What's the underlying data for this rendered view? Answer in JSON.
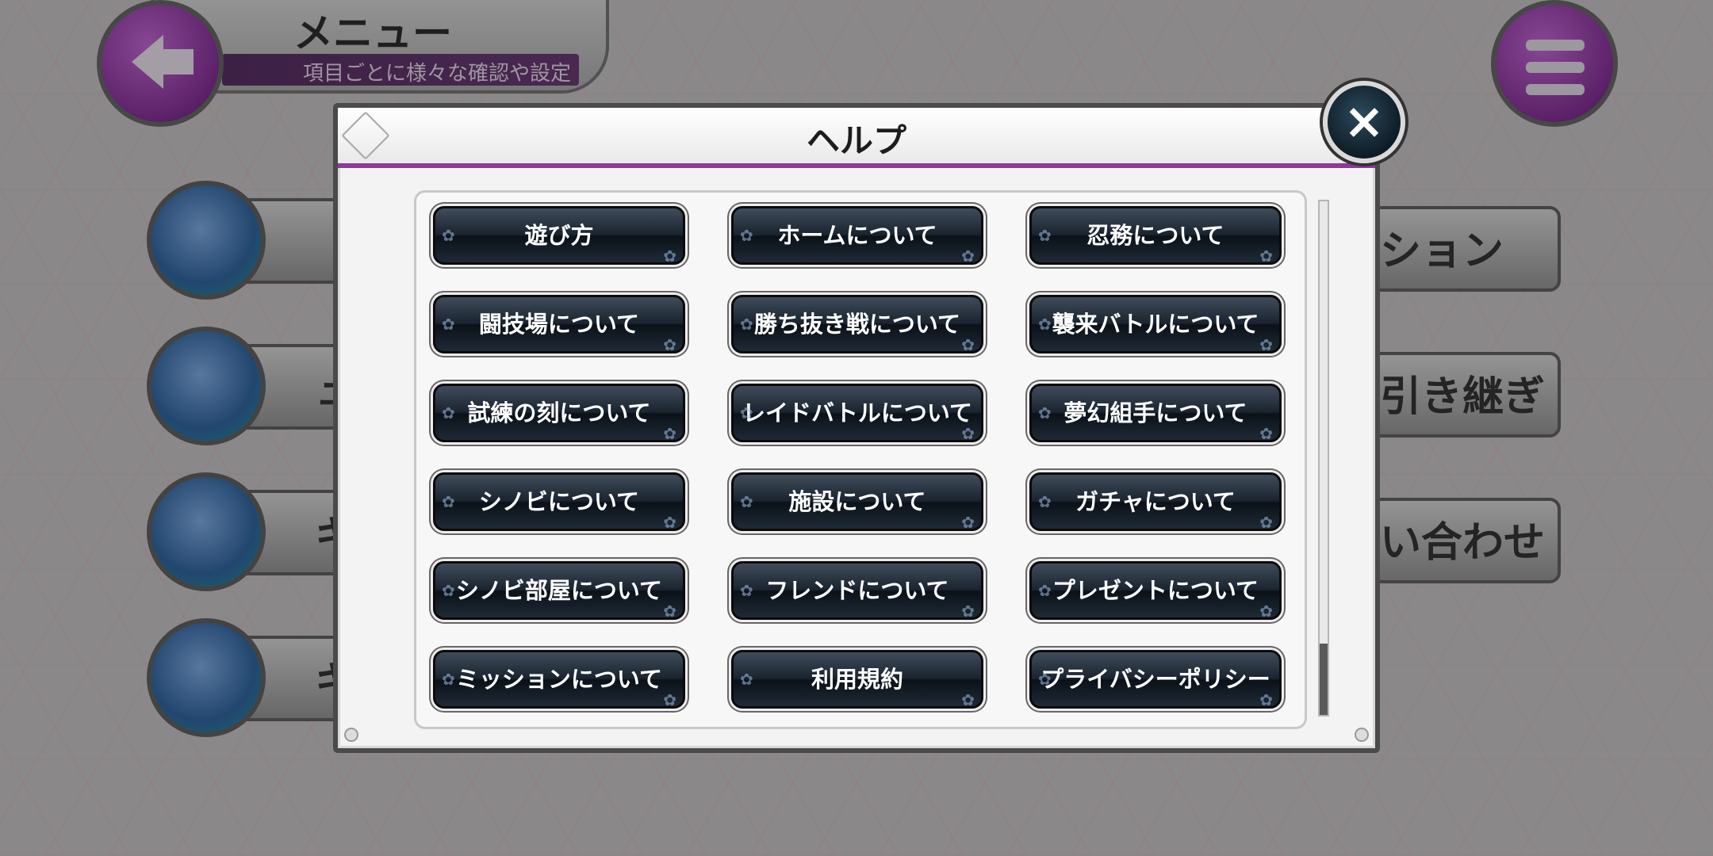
{
  "header": {
    "title": "メニュー",
    "subtitle": "項目ごとに様々な確認や設定"
  },
  "background_menu": {
    "items": [
      {
        "label": "ション",
        "icon": "scroll-icon"
      },
      {
        "label": "引き継ぎ",
        "icon": "document-icon"
      },
      {
        "label": "い合わせ",
        "icon": "broom-icon"
      },
      {
        "label": "",
        "icon": "shopping-bag-icon"
      }
    ],
    "left_fragments": [
      "ュ",
      "キ",
      "キ"
    ]
  },
  "dialog": {
    "title": "ヘルプ",
    "close_icon": "×",
    "buttons": [
      "遊び方",
      "ホームについて",
      "忍務について",
      "闘技場について",
      "勝ち抜き戦について",
      "襲来バトルについて",
      "試練の刻について",
      "レイドバトルについて",
      "夢幻組手について",
      "シノビについて",
      "施設について",
      "ガチャについて",
      "シノビ部屋について",
      "フレンドについて",
      "プレゼントについて",
      "ミッションについて",
      "利用規約",
      "プライバシーポリシー"
    ]
  },
  "colors": {
    "accent_purple": "#8a3b95",
    "button_dark": "#1b2430",
    "backdrop": "#b9b6b8"
  }
}
